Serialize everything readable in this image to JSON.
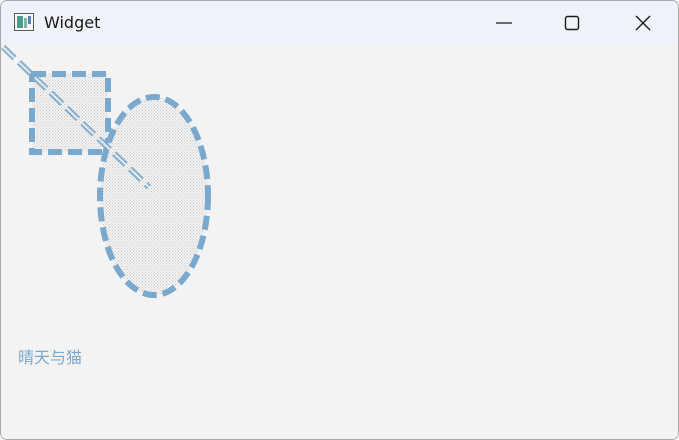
{
  "window": {
    "title": "Widget"
  },
  "title_controls": {
    "minimize_icon": "minimize-icon",
    "maximize_icon": "maximize-icon",
    "close_icon": "close-icon"
  },
  "canvas": {
    "stroke_color": "#7ba9cd",
    "fill_pattern_color": "#c9c9c9",
    "caption": "晴天与猫"
  }
}
